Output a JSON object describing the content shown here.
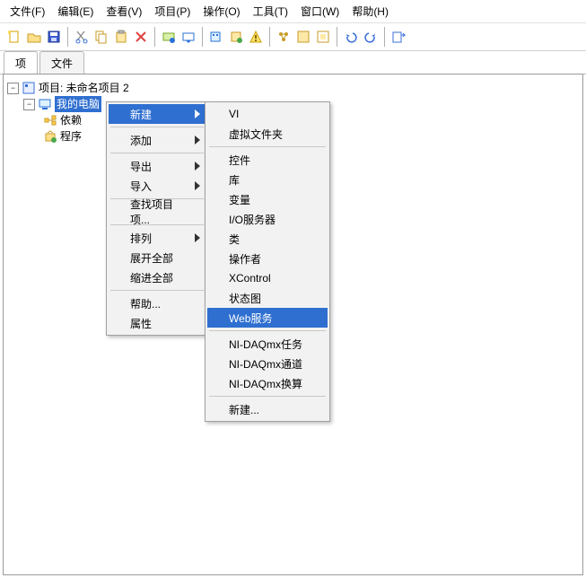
{
  "menubar": [
    "文件(F)",
    "编辑(E)",
    "查看(V)",
    "项目(P)",
    "操作(O)",
    "工具(T)",
    "窗口(W)",
    "帮助(H)"
  ],
  "tabs": {
    "items": [
      "项",
      "文件"
    ],
    "active": 0
  },
  "tree": {
    "root": "项目: 未命名项目 2",
    "node_my_computer": "我的电脑",
    "node_deps": "依赖",
    "node_build": "程序"
  },
  "ctx1": {
    "items": [
      {
        "label": "新建",
        "arrow": true,
        "hl": true
      },
      {
        "sep": true
      },
      {
        "label": "添加",
        "arrow": true
      },
      {
        "sep": true
      },
      {
        "label": "导出",
        "arrow": true
      },
      {
        "label": "导入",
        "arrow": true
      },
      {
        "sep": true
      },
      {
        "label": "查找项目项..."
      },
      {
        "sep": true
      },
      {
        "label": "排列",
        "arrow": true
      },
      {
        "label": "展开全部"
      },
      {
        "label": "缩进全部"
      },
      {
        "sep": true
      },
      {
        "label": "帮助..."
      },
      {
        "label": "属性"
      }
    ]
  },
  "ctx2": {
    "items": [
      {
        "label": "VI"
      },
      {
        "label": "虚拟文件夹"
      },
      {
        "sep": true
      },
      {
        "label": "控件"
      },
      {
        "label": "库"
      },
      {
        "label": "变量"
      },
      {
        "label": "I/O服务器"
      },
      {
        "label": "类"
      },
      {
        "label": "操作者"
      },
      {
        "label": "XControl"
      },
      {
        "label": "状态图"
      },
      {
        "label": "Web服务",
        "hl": true
      },
      {
        "sep": true
      },
      {
        "label": "NI-DAQmx任务"
      },
      {
        "label": "NI-DAQmx通道"
      },
      {
        "label": "NI-DAQmx换算"
      },
      {
        "sep": true
      },
      {
        "label": "新建..."
      }
    ]
  }
}
